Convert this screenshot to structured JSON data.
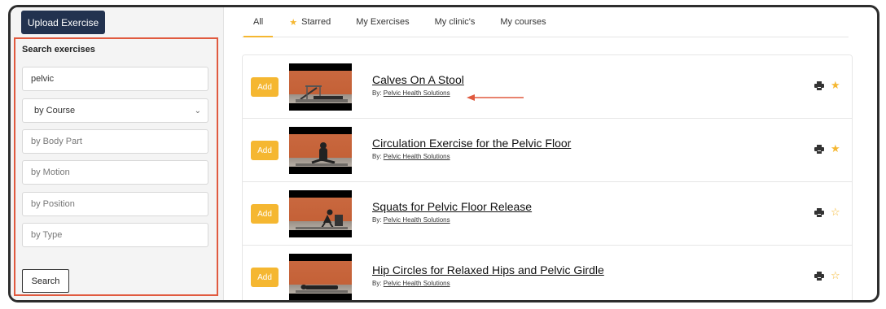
{
  "sidebar": {
    "upload_label": "Upload Exercise",
    "search": {
      "heading": "Search exercises",
      "query_value": "pelvic",
      "course_select": "by Course",
      "body_part_placeholder": "by Body Part",
      "motion_placeholder": "by Motion",
      "position_placeholder": "by Position",
      "type_placeholder": "by Type",
      "search_button": "Search"
    }
  },
  "tabs": [
    {
      "label": "All"
    },
    {
      "label": "Starred",
      "icon": "star-icon"
    },
    {
      "label": "My Exercises"
    },
    {
      "label": "My clinic's"
    },
    {
      "label": "My courses"
    }
  ],
  "active_tab": "All",
  "exercises": [
    {
      "add_label": "Add",
      "title": "Calves On A Stool",
      "by_prefix": "By:",
      "author": "Pelvic Health Solutions",
      "starred": true
    },
    {
      "add_label": "Add",
      "title": "Circulation Exercise for the Pelvic Floor",
      "by_prefix": "By:",
      "author": "Pelvic Health Solutions",
      "starred": true
    },
    {
      "add_label": "Add",
      "title": "Squats for Pelvic Floor Release",
      "by_prefix": "By:",
      "author": "Pelvic Health Solutions",
      "starred": false
    },
    {
      "add_label": "Add",
      "title": "Hip Circles for Relaxed Hips and Pelvic Girdle",
      "by_prefix": "By:",
      "author": "Pelvic Health Solutions",
      "starred": false
    }
  ],
  "colors": {
    "accent": "#f5b731",
    "highlight_border": "#e05a3f",
    "upload_button": "#22324f"
  },
  "icons": {
    "print": "printer-icon",
    "star_filled": "star-icon",
    "star_empty": "star-outline-icon",
    "select": "chevron-down-icon"
  }
}
